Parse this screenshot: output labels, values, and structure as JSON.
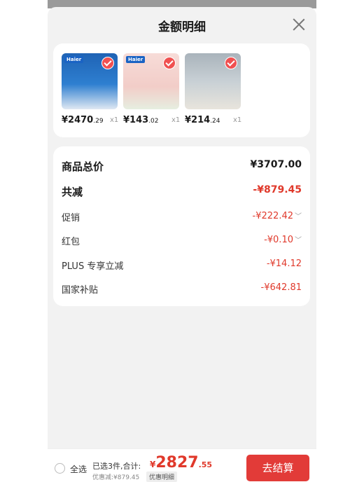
{
  "header": {
    "title": "金额明细"
  },
  "products": [
    {
      "brand": "Haier",
      "price_int": "¥2470",
      "price_dec": ".29",
      "qty": "x1",
      "thumb_color": "#2d6fb8"
    },
    {
      "brand": "Haier",
      "price_int": "¥143",
      "price_dec": ".02",
      "qty": "x1",
      "thumb_color": "#f3d6d3"
    },
    {
      "brand": "",
      "price_int": "¥214",
      "price_dec": ".24",
      "qty": "x1",
      "thumb_color": "#b9c2c8"
    }
  ],
  "summary": {
    "total": {
      "label": "商品总价",
      "value": "¥3707.00"
    },
    "reduce": {
      "label": "共减",
      "value": "-¥879.45"
    },
    "promo": {
      "label": "促销",
      "value": "-¥222.42"
    },
    "redpacket": {
      "label": "红包",
      "value": "-¥0.10"
    },
    "plus": {
      "label": "PLUS 专享立减",
      "value": "-¥14.12"
    },
    "subsidy": {
      "label": "国家补贴",
      "value": "-¥642.81"
    }
  },
  "footer": {
    "select_all": "全选",
    "selected_info": "已选3件,合计:",
    "sum_currency": "¥",
    "sum_int": "2827",
    "sum_dec": ".55",
    "discount_text": "优惠减:¥879.45",
    "discount_button": "优惠明细",
    "checkout": "去结算"
  },
  "colors": {
    "accent": "#e23b38",
    "price_red": "#e0392b",
    "background": "#f2f2f2"
  }
}
